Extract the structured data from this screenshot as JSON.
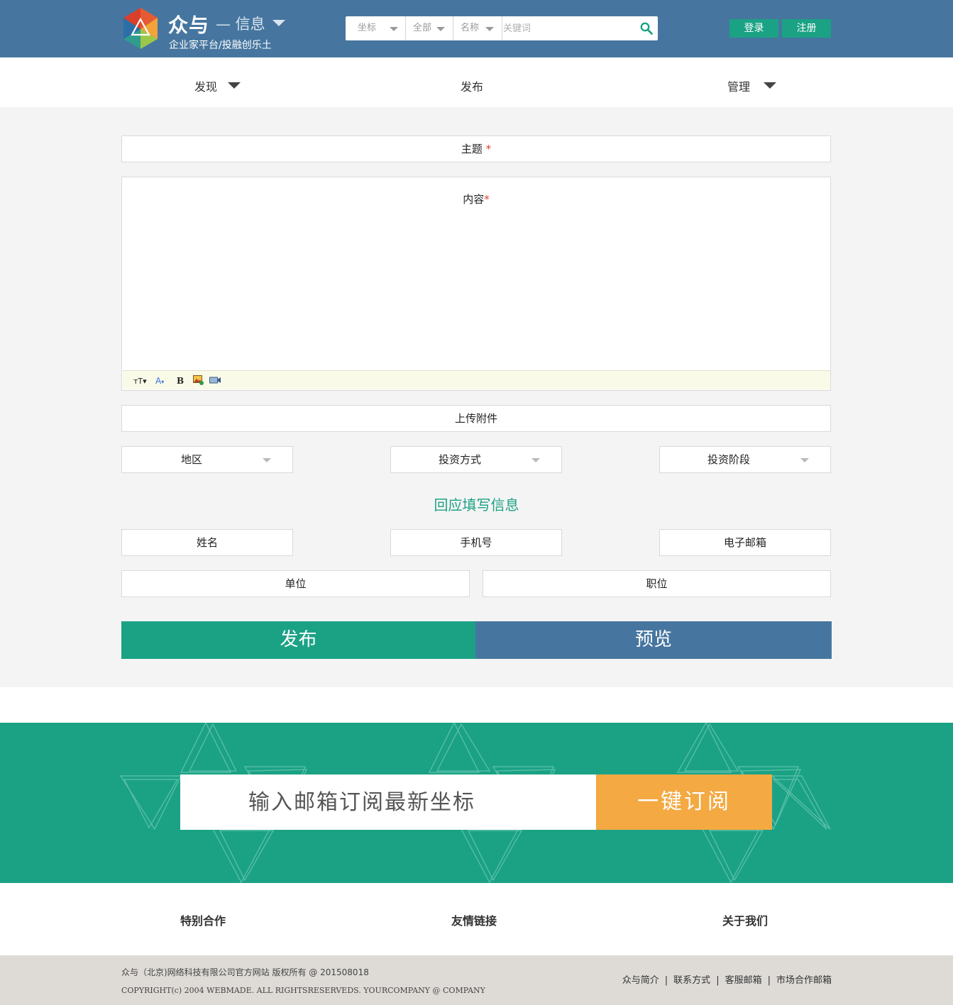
{
  "header": {
    "brand": "众与",
    "brand_sub": "— 信息",
    "tagline": "企业家平台/投融创乐土",
    "search": {
      "filter1": "坐标",
      "filter2": "全部",
      "filter3": "名称",
      "placeholder": "关键词"
    },
    "login": "登录",
    "register": "注册"
  },
  "nav": {
    "discover": "发现",
    "publish": "发布",
    "manage": "管理"
  },
  "form": {
    "subject_label": "主题",
    "subject_required": "*",
    "content_label": "内容",
    "content_required": "*",
    "toolbar": {
      "font_size": "T",
      "font_color": "A",
      "bold": "B"
    },
    "upload_label": "上传附件",
    "region": "地区",
    "invest_method": "投资方式",
    "invest_stage": "投资阶段",
    "reply_section_title": "回应填写信息",
    "name": "姓名",
    "phone": "手机号",
    "email": "电子邮箱",
    "company": "单位",
    "position": "职位",
    "publish_button": "发布",
    "preview_button": "预览"
  },
  "subscribe": {
    "placeholder": "输入邮箱订阅最新坐标",
    "button": "一键订阅"
  },
  "footer": {
    "links": [
      "特别合作",
      "友情链接",
      "关于我们"
    ],
    "copyright_cn": "众与（北京)网络科技有限公司官方网站  版权所有 @ 201508018",
    "copyright_en": "COPYRIGHT(c) 2004 WEBMADE. ALL RIGHTSRESERVEDS. YOURCOMPANY @ COMPANY",
    "bottom_links": [
      "众与简介",
      "联系方式",
      "客服邮箱",
      "市场合作邮箱"
    ]
  },
  "colors": {
    "header_blue": "#46769f",
    "accent_green": "#1ba285",
    "accent_orange": "#f4a942"
  }
}
